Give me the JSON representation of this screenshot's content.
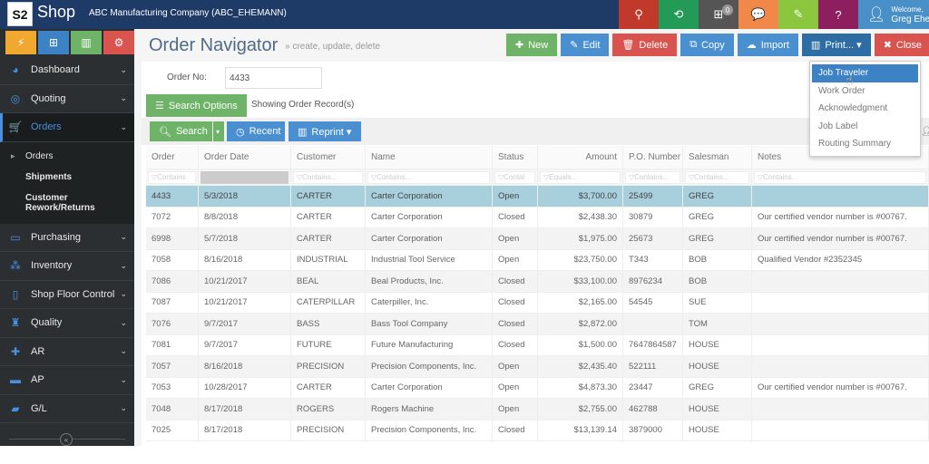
{
  "topbar": {
    "logo_text": "S2",
    "brand": "Shop",
    "company": "ABC Manufacturing Company    (ABC_EHEMANN)",
    "icons": [
      {
        "name": "rocket-icon",
        "glyph": "⚲",
        "color": "#c0392b"
      },
      {
        "name": "refresh-icon",
        "glyph": "⟲",
        "color": "#239b56"
      },
      {
        "name": "org-chart-icon",
        "glyph": "⊞",
        "color": "#555555",
        "badge": "0"
      },
      {
        "name": "chat-icon",
        "glyph": "💬",
        "color": "#f0884a"
      },
      {
        "name": "edit-icon",
        "glyph": "✎",
        "color": "#8cc63f"
      },
      {
        "name": "help-icon",
        "glyph": "?",
        "color": "#8e1f5e"
      }
    ],
    "user": {
      "welcome": "Welcome,",
      "name": "Greg Ehemann"
    }
  },
  "sidebar": {
    "top_buttons": [
      {
        "name": "lightning-button",
        "glyph": "⚡",
        "color": "#f0a830"
      },
      {
        "name": "sitemap-button",
        "glyph": "⊞",
        "color": "#3d82c4"
      },
      {
        "name": "chart-button",
        "glyph": "▥",
        "color": "#6fb368"
      },
      {
        "name": "gears-button",
        "glyph": "⚙",
        "color": "#d9534f"
      }
    ],
    "items_before": [
      {
        "label": "Dashboard",
        "icon": "dashboard-icon",
        "glyph": "◕"
      },
      {
        "label": "Quoting",
        "icon": "quoting-icon",
        "glyph": "◎"
      }
    ],
    "active": {
      "label": "Orders",
      "icon": "cart-icon",
      "glyph": "🛒"
    },
    "sub_items": [
      {
        "label": "Orders"
      },
      {
        "label": "Shipments"
      },
      {
        "label": "Customer Rework/Returns"
      }
    ],
    "items_after": [
      {
        "label": "Purchasing",
        "icon": "purchasing-icon",
        "glyph": "▭"
      },
      {
        "label": "Inventory",
        "icon": "inventory-icon",
        "glyph": "⁂"
      },
      {
        "label": "Shop Floor Control",
        "icon": "tablet-icon",
        "glyph": "▯"
      },
      {
        "label": "Quality",
        "icon": "trophy-icon",
        "glyph": "♜"
      },
      {
        "label": "AR",
        "icon": "plus-icon",
        "glyph": "✚"
      },
      {
        "label": "AP",
        "icon": "minus-icon",
        "glyph": "▬"
      },
      {
        "label": "G/L",
        "icon": "book-icon",
        "glyph": "▰"
      }
    ],
    "collapse_glyph": "«"
  },
  "page": {
    "title": "Order Navigator",
    "subtitle": "» create, update, delete"
  },
  "actions": [
    {
      "name": "new-button",
      "label": "New",
      "glyph": "✚",
      "cls": "green"
    },
    {
      "name": "edit-button",
      "label": "Edit",
      "glyph": "✎",
      "cls": "blue"
    },
    {
      "name": "delete-button",
      "label": "Delete",
      "glyph": "🗑",
      "cls": "red"
    },
    {
      "name": "copy-button",
      "label": "Copy",
      "glyph": "⧉",
      "cls": "blue"
    },
    {
      "name": "import-button",
      "label": "Import",
      "glyph": "☁",
      "cls": "blue"
    },
    {
      "name": "print-button",
      "label": "Print... ▾",
      "glyph": "▥",
      "cls": "dblue"
    },
    {
      "name": "close-button",
      "label": "Close",
      "glyph": "✖",
      "cls": "red"
    }
  ],
  "form": {
    "order_no_label": "Order No:",
    "order_no_value": "4433",
    "search_options_label": "Search Options",
    "showing_text": "Showing Order Record(s)"
  },
  "toolbar": {
    "search": "Search",
    "recent": "Recent",
    "reprint": "Reprint ▾"
  },
  "table": {
    "columns": [
      "Order",
      "Order Date",
      "Customer",
      "Name",
      "Status",
      "Amount",
      "P.O. Number",
      "Salesman",
      "Notes"
    ],
    "filters": [
      "Contains",
      "",
      "Contains...",
      "Contains...",
      "Contai",
      "Equals...",
      "Contains...",
      "Contains...",
      "Contains..."
    ],
    "rows": [
      [
        "4433",
        "5/3/2018",
        "CARTER",
        "Carter Corporation",
        "Open",
        "$3,700.00",
        "25499",
        "GREG",
        ""
      ],
      [
        "7072",
        "8/8/2018",
        "CARTER",
        "Carter Corporation",
        "Closed",
        "$2,438.30",
        "30879",
        "GREG",
        "Our certified vendor number is #00767."
      ],
      [
        "6998",
        "5/7/2018",
        "CARTER",
        "Carter Corporation",
        "Open",
        "$1,975.00",
        "25673",
        "GREG",
        "Our certified vendor number is #00767."
      ],
      [
        "7058",
        "8/16/2018",
        "INDUSTRIAL",
        "Industrial Tool Service",
        "Open",
        "$23,750.00",
        "T343",
        "BOB",
        "Qualified Vendor #2352345"
      ],
      [
        "7086",
        "10/21/2017",
        "BEAL",
        "Beal Products, Inc.",
        "Closed",
        "$33,100.00",
        "8976234",
        "BOB",
        ""
      ],
      [
        "7087",
        "10/21/2017",
        "CATERPILLAR",
        "Caterpiller, Inc.",
        "Closed",
        "$2,165.00",
        "54545",
        "SUE",
        ""
      ],
      [
        "7076",
        "9/7/2017",
        "BASS",
        "Bass Tool Company",
        "Closed",
        "$2,872.00",
        "",
        "TOM",
        ""
      ],
      [
        "7081",
        "9/7/2017",
        "FUTURE",
        "Future Manufacturing",
        "Closed",
        "$1,500.00",
        "7647864587",
        "HOUSE",
        ""
      ],
      [
        "7057",
        "8/16/2018",
        "PRECISION",
        "Precision Components, Inc.",
        "Open",
        "$2,435.40",
        "522111",
        "HOUSE",
        ""
      ],
      [
        "7053",
        "10/28/2017",
        "CARTER",
        "Carter Corporation",
        "Open",
        "$4,873.30",
        "23447",
        "GREG",
        "Our certified vendor number is #00767."
      ],
      [
        "7048",
        "8/17/2018",
        "ROGERS",
        "Rogers Machine",
        "Open",
        "$2,755.00",
        "462788",
        "HOUSE",
        ""
      ],
      [
        "7025",
        "8/17/2018",
        "PRECISION",
        "Precision Components, Inc.",
        "Closed",
        "$13,139.14",
        "3879000",
        "HOUSE",
        ""
      ]
    ]
  },
  "print_menu": {
    "items": [
      "Job Traveler",
      "Work Order",
      "Acknowledgment",
      "Job Label",
      "Routing Summary"
    ],
    "highlighted": 0
  }
}
